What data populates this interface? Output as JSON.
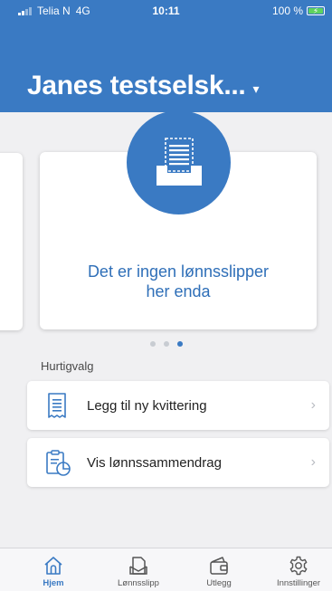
{
  "status_bar": {
    "carrier": "Telia N",
    "network": "4G",
    "time": "10:11",
    "battery": "100 %"
  },
  "header": {
    "company_name": "Janes testselsk...",
    "caret": "▾"
  },
  "carousel": {
    "empty_message_line1": "Det er ingen lønnsslipper",
    "empty_message_line2": "her enda",
    "page_count": 3,
    "active_page": 3
  },
  "quick_choices": {
    "title": "Hurtigvalg",
    "items": [
      {
        "label": "Legg til ny kvittering",
        "icon": "receipt-icon"
      },
      {
        "label": "Vis lønnssammendrag",
        "icon": "payroll-summary-icon"
      }
    ]
  },
  "tabs": [
    {
      "label": "Hjem",
      "icon": "home-icon",
      "active": true
    },
    {
      "label": "Lønnsslipp",
      "icon": "payslip-icon",
      "active": false
    },
    {
      "label": "Utlegg",
      "icon": "wallet-icon",
      "active": false
    },
    {
      "label": "Innstillinger",
      "icon": "gear-icon",
      "active": false
    }
  ],
  "colors": {
    "primary": "#3a7ac3",
    "background": "#f0f0f2",
    "battery": "#5ed35e"
  }
}
